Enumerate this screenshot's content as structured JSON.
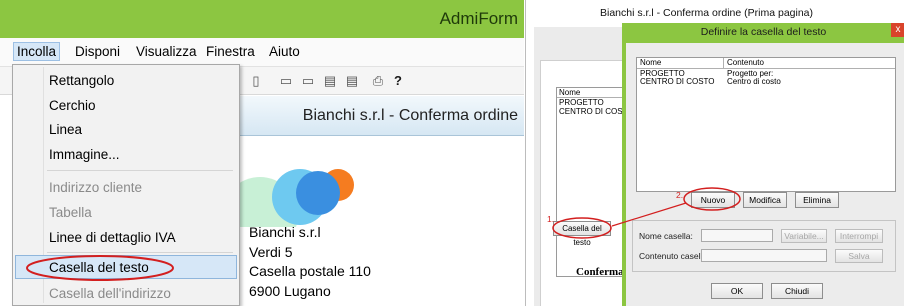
{
  "left": {
    "app_title": "AdmiForm",
    "menu": [
      "Incolla",
      "Disponi",
      "Visualizza",
      "Finestra",
      "Aiuto"
    ],
    "document_header": "Bianchi s.r.l - Conferma ordine",
    "dropdown": {
      "items": [
        {
          "label": "Rettangolo",
          "enabled": true
        },
        {
          "label": "Cerchio",
          "enabled": true
        },
        {
          "label": "Linea",
          "enabled": true
        },
        {
          "label": "Immagine...",
          "enabled": true
        },
        {
          "label": "Indirizzo cliente",
          "enabled": false
        },
        {
          "label": "Tabella",
          "enabled": false
        },
        {
          "label": "Linee di dettaglio IVA",
          "enabled": true
        },
        {
          "label": "Casella del testo",
          "enabled": true,
          "highlighted": true
        },
        {
          "label": "Casella dell'indirizzo",
          "enabled": false
        }
      ]
    },
    "address": [
      "Bianchi s.r.l",
      "Verdi 5",
      "Casella postale 110",
      "6900 Lugano"
    ],
    "colors": {
      "titlebar": "#8cc641",
      "highlight": "#d6e7f7",
      "callout": "#d31f1f"
    }
  },
  "right": {
    "window_title": "Bianchi s.r.l - Conferma ordine (Prima pagina)",
    "background_list": {
      "header": "Nome",
      "rows": [
        "PROGETTO",
        "CENTRO DI COSTO"
      ]
    },
    "background_button": "Casella del testo",
    "conferma_label": "Conferma",
    "dialog": {
      "title": "Definire la casella del testo",
      "close": "x",
      "columns": [
        "Nome",
        "Contenuto"
      ],
      "rows": [
        {
          "name": "PROGETTO",
          "content": "Progetto per:"
        },
        {
          "name": "CENTRO DI COSTO",
          "content": "Centro di costo"
        }
      ],
      "buttons": {
        "nuovo": "Nuovo",
        "modifica": "Modifica",
        "elimina": "Elimina"
      },
      "fields": {
        "nome_label": "Nome casella:",
        "contenuto_label": "Contenuto casella:",
        "variabile": "Variabile...",
        "interrompi": "Interrompi",
        "salva": "Salva"
      },
      "ok": "OK",
      "chiudi": "Chiudi"
    },
    "callouts": {
      "one": "1.",
      "two": "2."
    }
  }
}
